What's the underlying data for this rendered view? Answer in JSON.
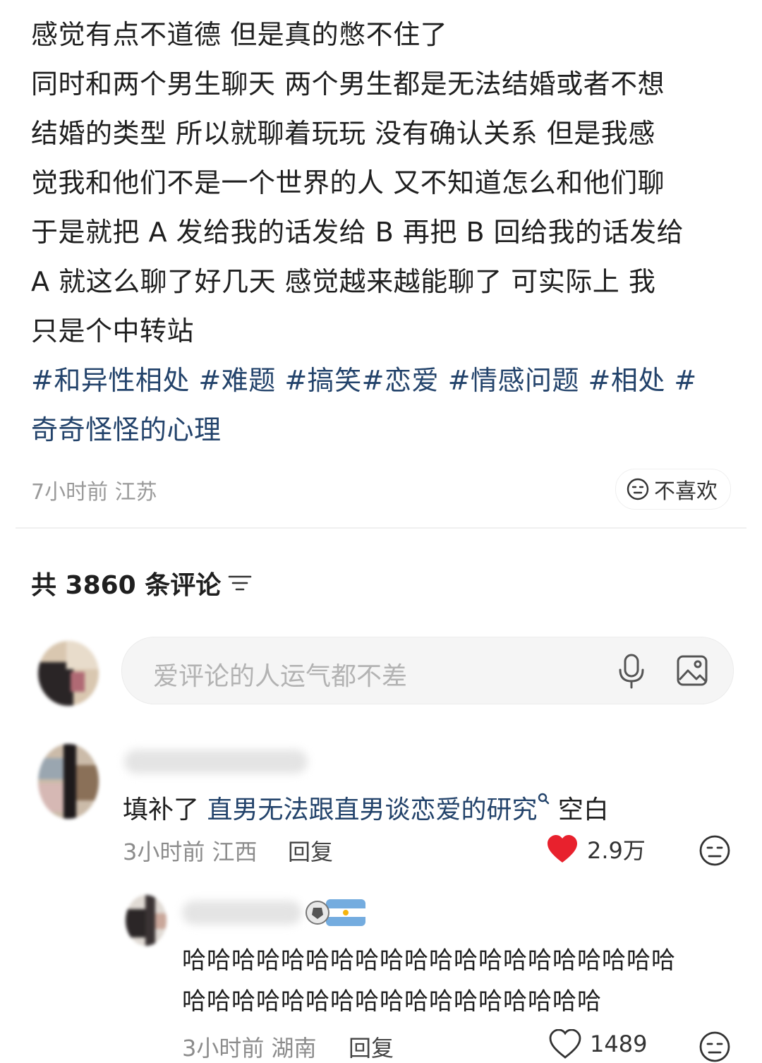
{
  "post": {
    "lines": [
      "感觉有点不道德 但是真的憋不住了",
      "同时和两个男生聊天 两个男生都是无法结婚或者不想",
      "结婚的类型 所以就聊着玩玩 没有确认关系 但是我感",
      "觉我和他们不是一个世界的人 又不知道怎么和他们聊",
      "于是就把 A 发给我的话发给 B 再把 B 回给我的话发给",
      " A 就这么聊了好几天 感觉越来越能聊了 可实际上 我",
      "只是个中转站"
    ],
    "tag_lines": [
      "#和异性相处 #难题 #搞笑#恋爱 #情感问题 #相处 #",
      "奇奇怪怪的心理"
    ],
    "meta": "7小时前 江苏",
    "dislike_label": "不喜欢"
  },
  "comments_header": {
    "label": "共 3860 条评论"
  },
  "comment_input": {
    "placeholder": "爱评论的人运气都不差"
  },
  "comments": [
    {
      "text_before": "填补了 ",
      "link_text": "直男无法跟直男谈恋爱的研究",
      "text_after": " 空白",
      "meta": "3小时前 江西",
      "reply_label": "回复",
      "likes": "2.9万",
      "liked": true
    }
  ],
  "reply": {
    "lines": [
      "哈哈哈哈哈哈哈哈哈哈哈哈哈哈哈哈哈哈哈哈",
      "哈哈哈哈哈哈哈哈哈哈哈哈哈哈哈哈哈"
    ],
    "meta": "3小时前 湖南",
    "reply_label": "回复",
    "likes": "1489"
  },
  "colors": {
    "hashtag": "#23436b",
    "like_red": "#e8212d",
    "meta_gray": "#8c8c8c"
  }
}
